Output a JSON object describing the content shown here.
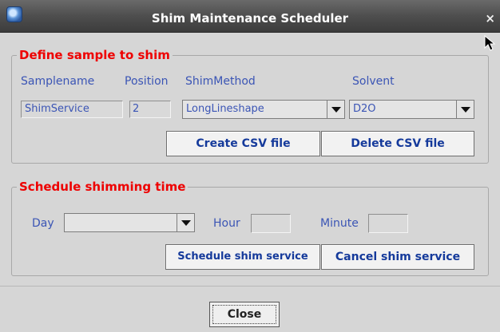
{
  "window": {
    "title": "Shim Maintenance Scheduler",
    "close_glyph": "×"
  },
  "sample": {
    "legend": "Define sample to shim",
    "labels": {
      "samplename": "Samplename",
      "position": "Position",
      "shimmethod": "ShimMethod",
      "solvent": "Solvent"
    },
    "samplename_value": "ShimService",
    "position_value": "2",
    "shimmethod_value": "LongLineshape",
    "solvent_value": "D2O",
    "create_csv_label": "Create CSV file",
    "delete_csv_label": "Delete CSV file"
  },
  "schedule": {
    "legend": "Schedule shimming time",
    "day_label": "Day",
    "day_value": "",
    "hour_label": "Hour",
    "hour_value": "",
    "minute_label": "Minute",
    "minute_value": "",
    "schedule_label": "Schedule shim service",
    "cancel_label": "Cancel shim service"
  },
  "footer": {
    "close_label": "Close"
  },
  "colors": {
    "legend": "#ee0000",
    "label": "#3b55b5",
    "button_text": "#153a9b"
  }
}
